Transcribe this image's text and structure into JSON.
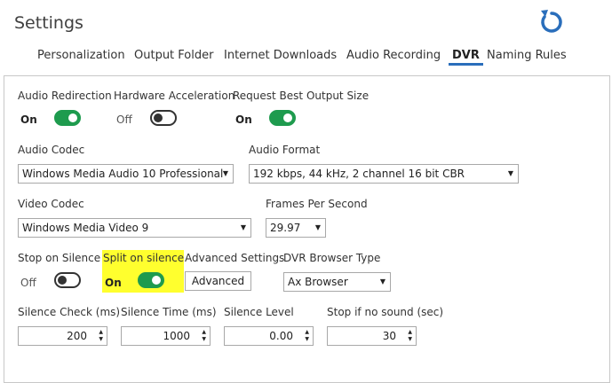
{
  "header": {
    "title": "Settings",
    "refresh_icon": "refresh-icon",
    "accent": "#2a6ebb"
  },
  "tabs": [
    {
      "label": "Personalization"
    },
    {
      "label": "Output Folder"
    },
    {
      "label": "Internet Downloads"
    },
    {
      "label": "Audio Recording"
    },
    {
      "label": "DVR",
      "active": true
    },
    {
      "label": "Naming Rules"
    }
  ],
  "toggles": {
    "audio_redirection": {
      "label": "Audio Redirection",
      "state": "On"
    },
    "hardware_acceleration": {
      "label": "Hardware Acceleration",
      "state": "Off"
    },
    "request_best_output": {
      "label": "Request Best Output Size",
      "state": "On"
    },
    "stop_on_silence": {
      "label": "Stop on Silence",
      "state": "Off"
    },
    "split_on_silence": {
      "label": "Split on silence",
      "state": "On"
    }
  },
  "fields": {
    "audio_codec": {
      "label": "Audio Codec",
      "value": "Windows Media Audio 10 Professional"
    },
    "audio_format": {
      "label": "Audio Format",
      "value": "192 kbps, 44 kHz, 2 channel 16 bit CBR"
    },
    "video_codec": {
      "label": "Video Codec",
      "value": "Windows Media Video 9"
    },
    "frames_per_second": {
      "label": "Frames Per Second",
      "value": "29.97"
    },
    "advanced_settings": {
      "label": "Advanced Settings",
      "button": "Advanced"
    },
    "dvr_browser_type": {
      "label": "DVR Browser Type",
      "value": "Ax Browser"
    },
    "silence_check": {
      "label": "Silence Check (ms)",
      "value": "200"
    },
    "silence_time": {
      "label": "Silence Time (ms)",
      "value": "1000"
    },
    "silence_level": {
      "label": "Silence Level",
      "value": "0.00"
    },
    "stop_if_no_sound": {
      "label": "Stop if no sound (sec)",
      "value": "30"
    }
  },
  "colors": {
    "toggle_on": "#1e9b4e",
    "highlight": "#ffff2e"
  }
}
